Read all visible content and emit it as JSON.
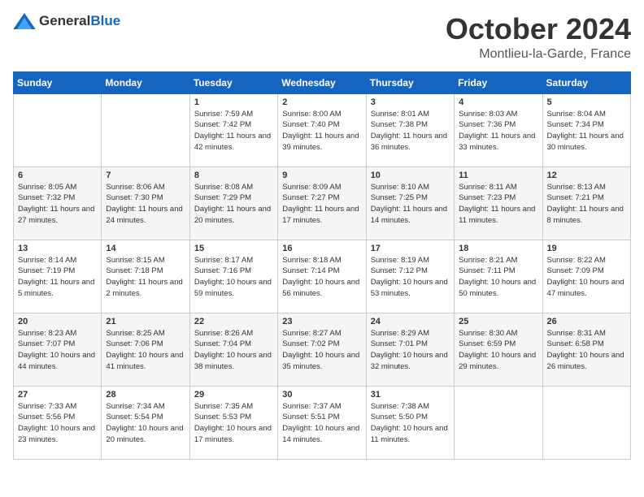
{
  "logo": {
    "general": "General",
    "blue": "Blue"
  },
  "title": "October 2024",
  "location": "Montlieu-la-Garde, France",
  "days_header": [
    "Sunday",
    "Monday",
    "Tuesday",
    "Wednesday",
    "Thursday",
    "Friday",
    "Saturday"
  ],
  "weeks": [
    [
      {
        "day": "",
        "info": ""
      },
      {
        "day": "",
        "info": ""
      },
      {
        "day": "1",
        "info": "Sunrise: 7:59 AM\nSunset: 7:42 PM\nDaylight: 11 hours and 42 minutes."
      },
      {
        "day": "2",
        "info": "Sunrise: 8:00 AM\nSunset: 7:40 PM\nDaylight: 11 hours and 39 minutes."
      },
      {
        "day": "3",
        "info": "Sunrise: 8:01 AM\nSunset: 7:38 PM\nDaylight: 11 hours and 36 minutes."
      },
      {
        "day": "4",
        "info": "Sunrise: 8:03 AM\nSunset: 7:36 PM\nDaylight: 11 hours and 33 minutes."
      },
      {
        "day": "5",
        "info": "Sunrise: 8:04 AM\nSunset: 7:34 PM\nDaylight: 11 hours and 30 minutes."
      }
    ],
    [
      {
        "day": "6",
        "info": "Sunrise: 8:05 AM\nSunset: 7:32 PM\nDaylight: 11 hours and 27 minutes."
      },
      {
        "day": "7",
        "info": "Sunrise: 8:06 AM\nSunset: 7:30 PM\nDaylight: 11 hours and 24 minutes."
      },
      {
        "day": "8",
        "info": "Sunrise: 8:08 AM\nSunset: 7:29 PM\nDaylight: 11 hours and 20 minutes."
      },
      {
        "day": "9",
        "info": "Sunrise: 8:09 AM\nSunset: 7:27 PM\nDaylight: 11 hours and 17 minutes."
      },
      {
        "day": "10",
        "info": "Sunrise: 8:10 AM\nSunset: 7:25 PM\nDaylight: 11 hours and 14 minutes."
      },
      {
        "day": "11",
        "info": "Sunrise: 8:11 AM\nSunset: 7:23 PM\nDaylight: 11 hours and 11 minutes."
      },
      {
        "day": "12",
        "info": "Sunrise: 8:13 AM\nSunset: 7:21 PM\nDaylight: 11 hours and 8 minutes."
      }
    ],
    [
      {
        "day": "13",
        "info": "Sunrise: 8:14 AM\nSunset: 7:19 PM\nDaylight: 11 hours and 5 minutes."
      },
      {
        "day": "14",
        "info": "Sunrise: 8:15 AM\nSunset: 7:18 PM\nDaylight: 11 hours and 2 minutes."
      },
      {
        "day": "15",
        "info": "Sunrise: 8:17 AM\nSunset: 7:16 PM\nDaylight: 10 hours and 59 minutes."
      },
      {
        "day": "16",
        "info": "Sunrise: 8:18 AM\nSunset: 7:14 PM\nDaylight: 10 hours and 56 minutes."
      },
      {
        "day": "17",
        "info": "Sunrise: 8:19 AM\nSunset: 7:12 PM\nDaylight: 10 hours and 53 minutes."
      },
      {
        "day": "18",
        "info": "Sunrise: 8:21 AM\nSunset: 7:11 PM\nDaylight: 10 hours and 50 minutes."
      },
      {
        "day": "19",
        "info": "Sunrise: 8:22 AM\nSunset: 7:09 PM\nDaylight: 10 hours and 47 minutes."
      }
    ],
    [
      {
        "day": "20",
        "info": "Sunrise: 8:23 AM\nSunset: 7:07 PM\nDaylight: 10 hours and 44 minutes."
      },
      {
        "day": "21",
        "info": "Sunrise: 8:25 AM\nSunset: 7:06 PM\nDaylight: 10 hours and 41 minutes."
      },
      {
        "day": "22",
        "info": "Sunrise: 8:26 AM\nSunset: 7:04 PM\nDaylight: 10 hours and 38 minutes."
      },
      {
        "day": "23",
        "info": "Sunrise: 8:27 AM\nSunset: 7:02 PM\nDaylight: 10 hours and 35 minutes."
      },
      {
        "day": "24",
        "info": "Sunrise: 8:29 AM\nSunset: 7:01 PM\nDaylight: 10 hours and 32 minutes."
      },
      {
        "day": "25",
        "info": "Sunrise: 8:30 AM\nSunset: 6:59 PM\nDaylight: 10 hours and 29 minutes."
      },
      {
        "day": "26",
        "info": "Sunrise: 8:31 AM\nSunset: 6:58 PM\nDaylight: 10 hours and 26 minutes."
      }
    ],
    [
      {
        "day": "27",
        "info": "Sunrise: 7:33 AM\nSunset: 5:56 PM\nDaylight: 10 hours and 23 minutes."
      },
      {
        "day": "28",
        "info": "Sunrise: 7:34 AM\nSunset: 5:54 PM\nDaylight: 10 hours and 20 minutes."
      },
      {
        "day": "29",
        "info": "Sunrise: 7:35 AM\nSunset: 5:53 PM\nDaylight: 10 hours and 17 minutes."
      },
      {
        "day": "30",
        "info": "Sunrise: 7:37 AM\nSunset: 5:51 PM\nDaylight: 10 hours and 14 minutes."
      },
      {
        "day": "31",
        "info": "Sunrise: 7:38 AM\nSunset: 5:50 PM\nDaylight: 10 hours and 11 minutes."
      },
      {
        "day": "",
        "info": ""
      },
      {
        "day": "",
        "info": ""
      }
    ]
  ]
}
